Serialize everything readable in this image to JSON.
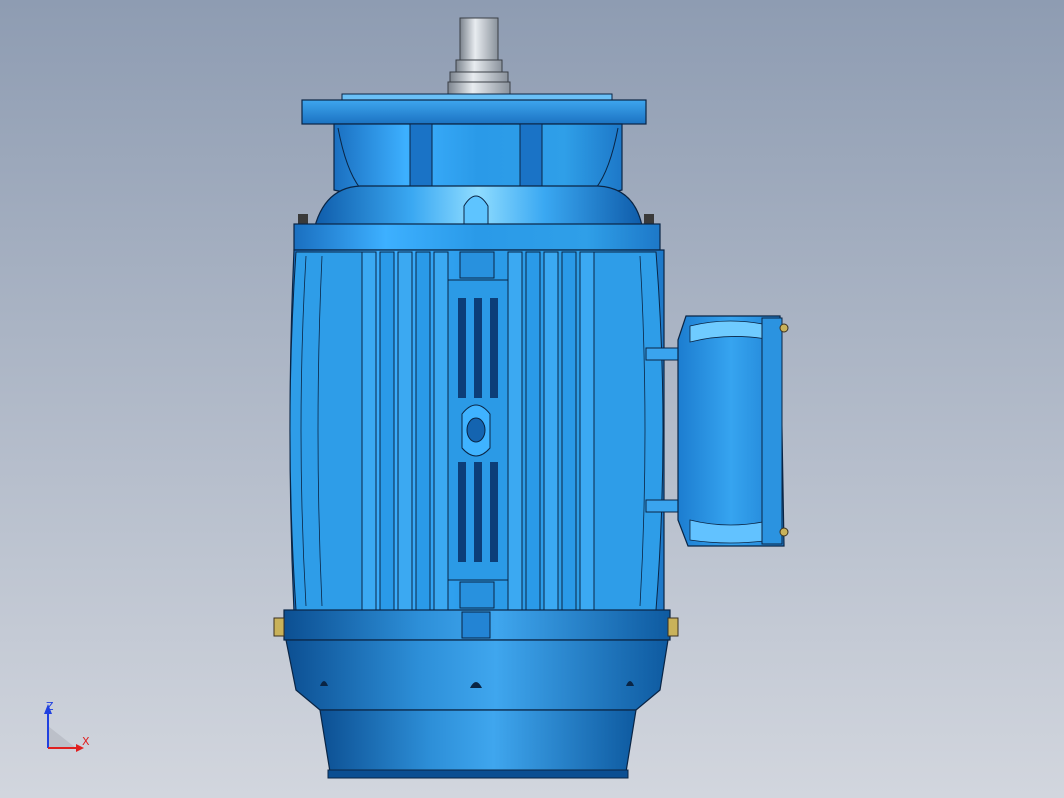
{
  "viewport": {
    "background_top": "#8e9cb2",
    "background_bottom": "#d2d6de"
  },
  "model": {
    "name": "motor-assembly",
    "colors": {
      "body_blue": "#2a9ae8",
      "body_light": "#5ec4ff",
      "body_dark": "#0a4d8c",
      "edge_line": "#0a2545",
      "shaft_metal": "#b8bec6"
    }
  },
  "triad": {
    "z_label": "Z",
    "x_label": "X",
    "x_color": "#e02020",
    "z_color": "#2040e0"
  }
}
